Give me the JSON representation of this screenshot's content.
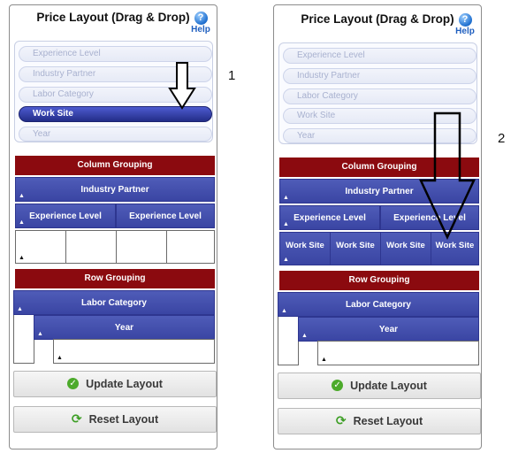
{
  "panels": [
    {
      "step": "1",
      "title": "Price Layout (Drag & Drop)",
      "help_label": "Help",
      "available_fields": [
        "Experience Level",
        "Industry Partner",
        "Labor Category",
        "Work Site",
        "Year"
      ],
      "selected_field": "Work Site",
      "column_grouping": {
        "header": "Column Grouping",
        "level1": [
          "Industry Partner"
        ],
        "level2": [
          "Experience Level",
          "Experience Level"
        ],
        "level3": []
      },
      "row_grouping": {
        "header": "Row Grouping",
        "levels": [
          "Labor Category",
          "Year"
        ]
      },
      "buttons": {
        "update": "Update Layout",
        "reset": "Reset Layout"
      }
    },
    {
      "step": "2",
      "title": "Price Layout (Drag & Drop)",
      "help_label": "Help",
      "available_fields": [
        "Experience Level",
        "Industry Partner",
        "Labor Category",
        "Work Site",
        "Year"
      ],
      "selected_field": "",
      "column_grouping": {
        "header": "Column Grouping",
        "level1": [
          "Industry Partner"
        ],
        "level2": [
          "Experience Level",
          "Experience Level"
        ],
        "level3": [
          "Work Site",
          "Work Site",
          "Work Site",
          "Work Site"
        ]
      },
      "row_grouping": {
        "header": "Row Grouping",
        "levels": [
          "Labor Category",
          "Year"
        ]
      },
      "buttons": {
        "update": "Update Layout",
        "reset": "Reset Layout"
      }
    }
  ],
  "icons": {
    "help": "help-icon",
    "sort_arrow": "sort-up-triangle-icon",
    "update": "checkmark-circle-icon",
    "reset": "refresh-icon",
    "annotation": "down-arrow-annotation"
  },
  "colors": {
    "group_header": "#8b0a0f",
    "field_bar": "#3f4aa8",
    "selected_chip": "#2a348f",
    "check_green": "#4caa2b"
  }
}
